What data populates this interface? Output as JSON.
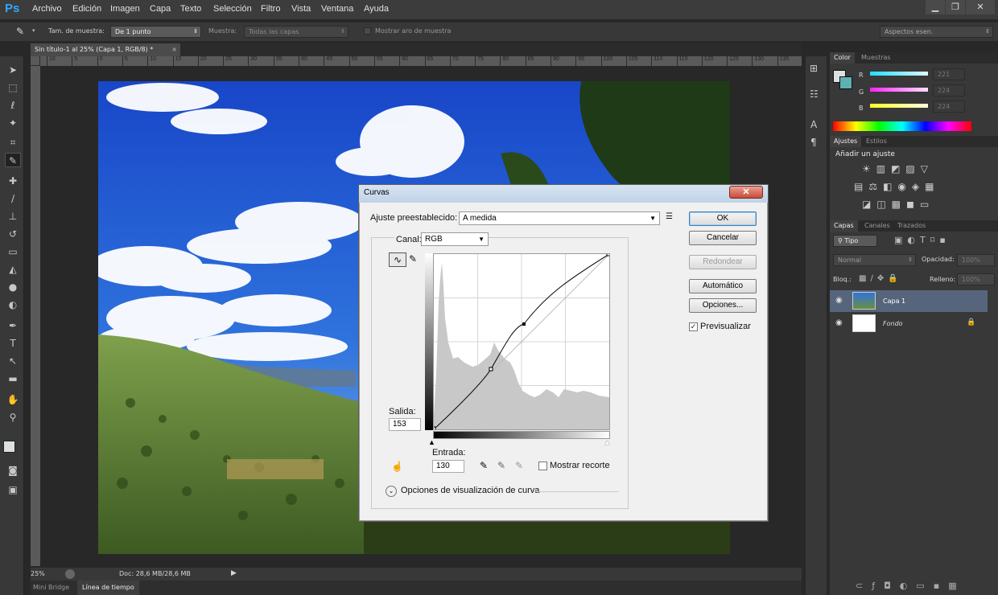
{
  "app": {
    "logo": "Ps",
    "menu": [
      "Archivo",
      "Edición",
      "Imagen",
      "Capa",
      "Texto",
      "Selección",
      "Filtro",
      "Vista",
      "Ventana",
      "Ayuda"
    ]
  },
  "options_bar": {
    "sample_size_label": "Tam. de muestra:",
    "sample_size_value": "De 1 punto",
    "sample_label": "Muestra:",
    "sample_value": "Todas las capas",
    "show_ring_label": "Mostrar aro de muestra",
    "workspace": "Aspectos esen."
  },
  "document": {
    "tab_title": "Sin título-1 al 25% (Capa 1, RGB/8) *",
    "ruler_ticks": [
      "10",
      "5",
      "0",
      "5",
      "10",
      "15",
      "20",
      "25",
      "30",
      "35",
      "40",
      "45",
      "50",
      "55",
      "60",
      "65",
      "70",
      "75",
      "80",
      "85",
      "90",
      "95",
      "100",
      "105",
      "110",
      "115",
      "120",
      "125",
      "130",
      "135"
    ],
    "zoom": "25%",
    "doc_info": "Doc: 28,6 MB/28,6 MB"
  },
  "bottom_tabs": [
    "Mini Bridge",
    "Línea de tiempo"
  ],
  "curves_dialog": {
    "title": "Curvas",
    "preset_label": "Ajuste preestablecido:",
    "preset_value": "A medida",
    "channel_label": "Canal:",
    "channel_value": "RGB",
    "output_label": "Salida:",
    "output_value": "153",
    "input_label": "Entrada:",
    "input_value": "130",
    "show_clipping_label": "Mostrar recorte",
    "display_options_label": "Opciones de visualización de curva",
    "buttons": {
      "ok": "OK",
      "cancel": "Cancelar",
      "smooth": "Redondear",
      "auto": "Automático",
      "options": "Opciones..."
    },
    "preview_label": "Previsualizar",
    "preview_checked": true
  },
  "color_panel": {
    "tabs": [
      "Color",
      "Muestras"
    ],
    "channels": [
      {
        "label": "R",
        "value": "221",
        "color": "#00e5ff"
      },
      {
        "label": "G",
        "value": "224",
        "color": "#ff33ff"
      },
      {
        "label": "B",
        "value": "224",
        "color": "#ffff33"
      }
    ],
    "foreground": "#dde0e0",
    "background": "#5fb0b0"
  },
  "adjustments_panel": {
    "tabs": [
      "Ajustes",
      "Estilos"
    ],
    "heading": "Añadir un ajuste"
  },
  "layers_panel": {
    "tabs": [
      "Capas",
      "Canales",
      "Trazados"
    ],
    "filter_label": "Tipo",
    "blend_mode": "Normal",
    "opacity_label": "Opacidad:",
    "opacity_value": "100%",
    "lock_label": "Bloq.:",
    "fill_label": "Relleno:",
    "fill_value": "100%",
    "layers": [
      {
        "name": "Capa 1",
        "selected": true
      },
      {
        "name": "Fondo",
        "selected": false,
        "locked": true
      }
    ]
  }
}
